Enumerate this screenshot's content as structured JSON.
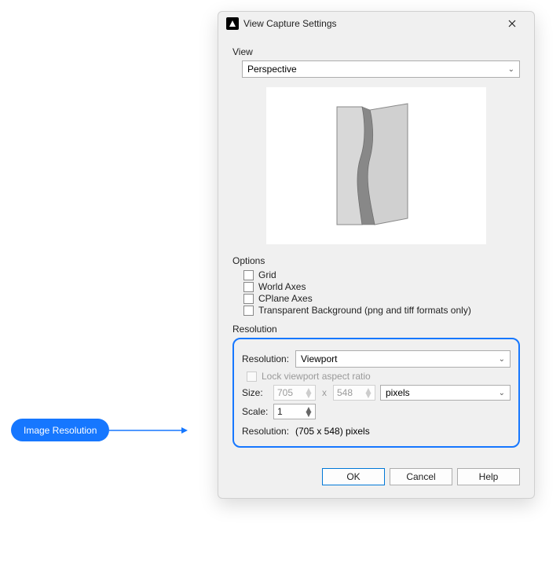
{
  "dialog": {
    "title": "View Capture Settings",
    "view_section_label": "View",
    "view_value": "Perspective",
    "options_section_label": "Options",
    "options": {
      "grid": "Grid",
      "world_axes": "World Axes",
      "cplane_axes": "CPlane Axes",
      "transparent_bg": "Transparent Background (png and tiff formats only)"
    },
    "resolution_section_label": "Resolution",
    "resolution": {
      "label": "Resolution:",
      "value": "Viewport",
      "lock_label": "Lock viewport aspect ratio",
      "size_label": "Size:",
      "width": "705",
      "height": "548",
      "x": "x",
      "units": "pixels",
      "scale_label": "Scale:",
      "scale": "1",
      "result_label": "Resolution:",
      "result_value": "(705 x 548) pixels"
    },
    "buttons": {
      "ok": "OK",
      "cancel": "Cancel",
      "help": "Help"
    }
  },
  "callout": {
    "label": "Image Resolution"
  }
}
